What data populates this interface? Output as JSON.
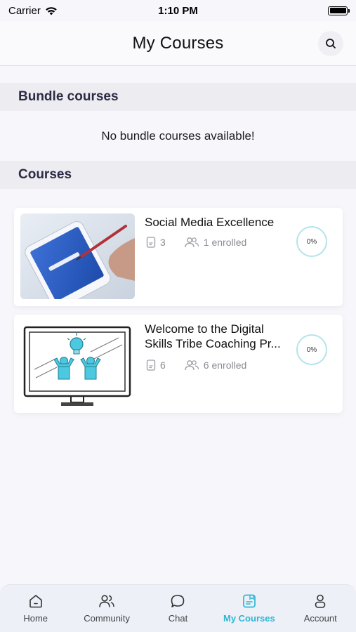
{
  "status_bar": {
    "carrier": "Carrier",
    "time": "1:10 PM"
  },
  "header": {
    "title": "My Courses"
  },
  "bundle_section": {
    "title": "Bundle courses",
    "empty_message": "No bundle courses available!"
  },
  "courses_section": {
    "title": "Courses",
    "items": [
      {
        "title": "Social Media Excellence",
        "lessons": "3",
        "enrolled": "1 enrolled",
        "progress": "0%",
        "thumbnail": "hand-tapping-phone-with-facebook"
      },
      {
        "title": "Welcome to the Digital Skills Tribe Coaching Pr...",
        "lessons": "6",
        "enrolled": "6 enrolled",
        "progress": "0%",
        "thumbnail": "monitor-with-two-people-and-lightbulb"
      }
    ]
  },
  "tab_bar": {
    "items": [
      {
        "label": "Home",
        "icon": "home-icon",
        "active": false
      },
      {
        "label": "Community",
        "icon": "community-icon",
        "active": false
      },
      {
        "label": "Chat",
        "icon": "chat-icon",
        "active": false
      },
      {
        "label": "My Courses",
        "icon": "my-courses-icon",
        "active": true
      },
      {
        "label": "Account",
        "icon": "account-icon",
        "active": false
      }
    ]
  },
  "colors": {
    "accent": "#2fb6d4",
    "section_bg": "#ededf1",
    "progress_ring": "#b5e3ec"
  }
}
